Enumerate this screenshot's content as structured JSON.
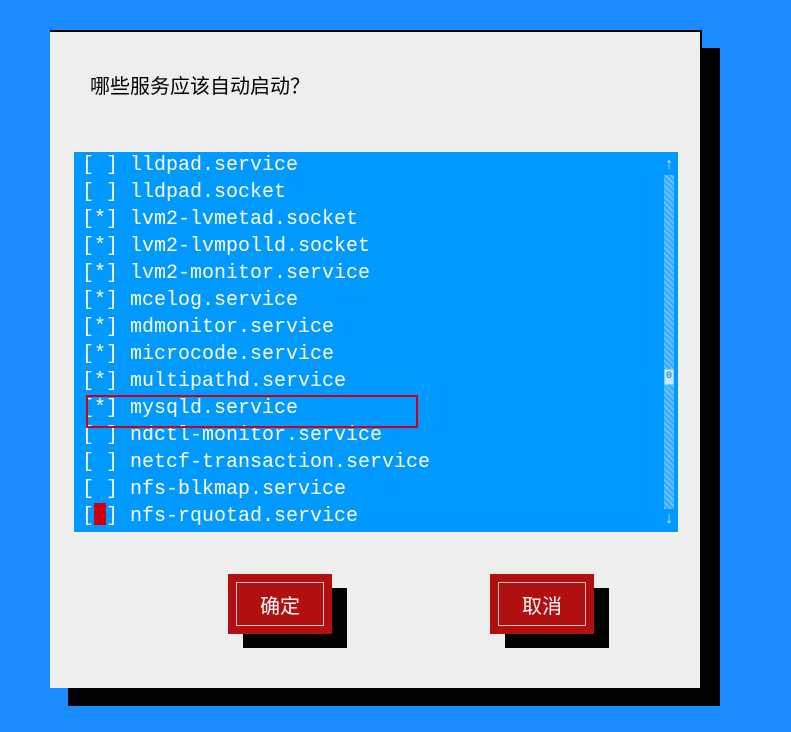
{
  "dialog": {
    "title": "哪些服务应该自动启动？"
  },
  "services": [
    {
      "checked": " ",
      "name": "lldpad.service"
    },
    {
      "checked": " ",
      "name": "lldpad.socket"
    },
    {
      "checked": "*",
      "name": "lvm2-lvmetad.socket"
    },
    {
      "checked": "*",
      "name": "lvm2-lvmpolld.socket"
    },
    {
      "checked": "*",
      "name": "lvm2-monitor.service"
    },
    {
      "checked": "*",
      "name": "mcelog.service"
    },
    {
      "checked": "*",
      "name": "mdmonitor.service"
    },
    {
      "checked": "*",
      "name": "microcode.service"
    },
    {
      "checked": "*",
      "name": "multipathd.service"
    },
    {
      "checked": "*",
      "name": "mysqld.service"
    },
    {
      "checked": " ",
      "name": "ndctl-monitor.service"
    },
    {
      "checked": " ",
      "name": "netcf-transaction.service"
    },
    {
      "checked": " ",
      "name": "nfs-blkmap.service"
    },
    {
      "checked": " ",
      "name": "nfs-rquotad.service"
    }
  ],
  "buttons": {
    "ok": "确定",
    "cancel": "取消"
  },
  "scroll": {
    "up": "↑",
    "down": "↓",
    "thumb": "0"
  },
  "highlighted_service_index": 9,
  "cursor_row_index": 13
}
